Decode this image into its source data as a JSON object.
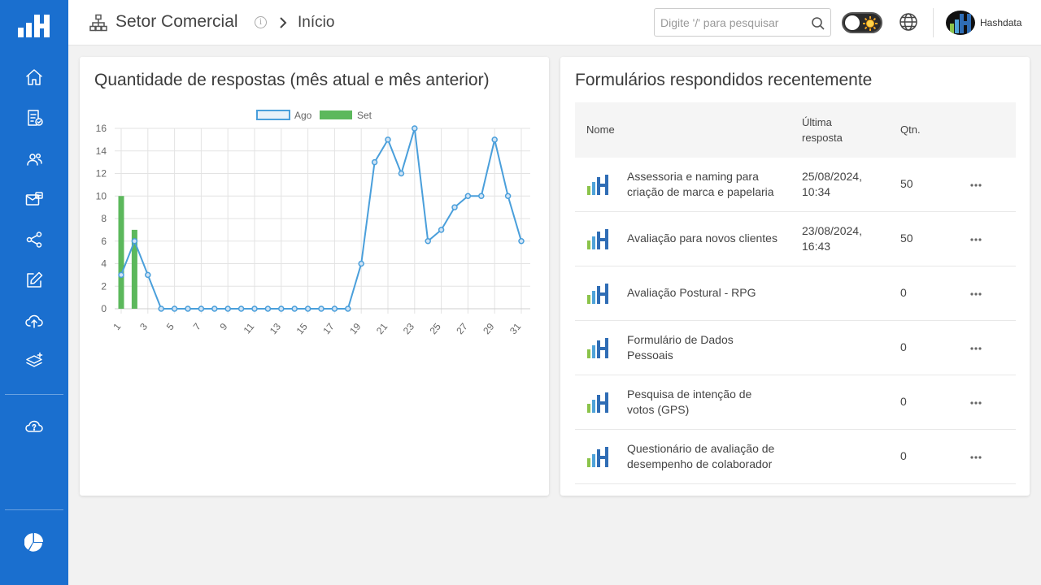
{
  "header": {
    "title": "Setor Comercial",
    "breadcrumb": "Início",
    "search_placeholder": "Digite '/' para pesquisar",
    "account_name": "Hashdata"
  },
  "sidebar": {
    "items": [
      {
        "icon": "home-icon"
      },
      {
        "icon": "form-check-icon"
      },
      {
        "icon": "users-icon"
      },
      {
        "icon": "inbox-icon"
      },
      {
        "icon": "share-icon"
      },
      {
        "icon": "edit-icon"
      },
      {
        "icon": "cloud-upload-icon"
      },
      {
        "icon": "layers-plus-icon"
      },
      {
        "icon": "cloud-help-icon"
      },
      {
        "icon": "pie-chart-icon"
      }
    ]
  },
  "colors": {
    "sidebar": "#1a6fcf",
    "line_series": "#4a9fdb",
    "bar_series": "#5cb85c"
  },
  "chart_card": {
    "title": "Quantidade de respostas (mês atual e mês anterior)"
  },
  "chart_data": {
    "type": "line",
    "title": "Quantidade de respostas (mês atual e mês anterior)",
    "legend_position": "top",
    "grid": true,
    "x": [
      1,
      2,
      3,
      4,
      5,
      6,
      7,
      8,
      9,
      10,
      11,
      12,
      13,
      14,
      15,
      16,
      17,
      18,
      19,
      20,
      21,
      22,
      23,
      24,
      25,
      26,
      27,
      28,
      29,
      30,
      31
    ],
    "x_tick_labels": [
      "1",
      "3",
      "5",
      "7",
      "9",
      "11",
      "13",
      "15",
      "17",
      "19",
      "21",
      "23",
      "25",
      "27",
      "29",
      "31"
    ],
    "y_ticks": [
      "0",
      "2",
      "4",
      "6",
      "8",
      "10",
      "12",
      "14",
      "16"
    ],
    "ylim": [
      0,
      16
    ],
    "series": [
      {
        "name": "Ago",
        "type": "line",
        "values": [
          3,
          6,
          3,
          0,
          0,
          0,
          0,
          0,
          0,
          0,
          0,
          0,
          0,
          0,
          0,
          0,
          0,
          0,
          4,
          13,
          15,
          12,
          16,
          6,
          7,
          9,
          10,
          10,
          15,
          10,
          6
        ]
      },
      {
        "name": "Set",
        "type": "bar",
        "values": [
          10,
          7,
          null,
          null,
          null,
          null,
          null,
          null,
          null,
          null,
          null,
          null,
          null,
          null,
          null,
          null,
          null,
          null,
          null,
          null,
          null,
          null,
          null,
          null,
          null,
          null,
          null,
          null,
          null,
          null,
          null
        ]
      }
    ]
  },
  "table_card": {
    "title": "Formulários respondidos recentemente",
    "columns": {
      "name": "Nome",
      "last_line1": "Última",
      "last_line2": "resposta",
      "qty": "Qtn."
    },
    "rows": [
      {
        "name1": "Assessoria e naming para",
        "name2": "criação de marca e papelaria",
        "date1": "25/08/2024,",
        "date2": "10:34",
        "qty": "50"
      },
      {
        "name1": "Avaliação para novos clientes",
        "name2": "",
        "date1": "23/08/2024,",
        "date2": "16:43",
        "qty": "50"
      },
      {
        "name1": "Avaliação Postural - RPG",
        "name2": "",
        "date1": "",
        "date2": "",
        "qty": "0"
      },
      {
        "name1": "Formulário de Dados",
        "name2": "Pessoais",
        "date1": "",
        "date2": "",
        "qty": "0"
      },
      {
        "name1": "Pesquisa de intenção de",
        "name2": "votos (GPS)",
        "date1": "",
        "date2": "",
        "qty": "0"
      },
      {
        "name1": "Questionário de avaliação de",
        "name2": "desempenho de colaborador",
        "date1": "",
        "date2": "",
        "qty": "0"
      }
    ]
  }
}
